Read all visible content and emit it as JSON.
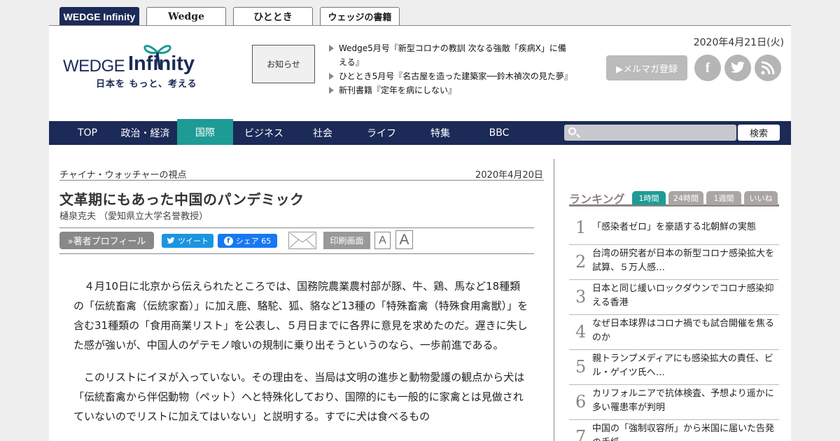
{
  "site_tabs": [
    "WEDGE Infinity",
    "Wedge",
    "ひととき",
    "ウェッジの書籍"
  ],
  "logo": {
    "wedge": "WEDGE",
    "infinity": "Infinity",
    "tagline": "日本を もっと、考える"
  },
  "notice_label": "お知らせ",
  "news": [
    "Wedge5月号『新型コロナの教訓 次なる強敵「疾病X」に備える』",
    "ひととき5月号『名古屋を造った建築家──鈴木禎次の見た夢』",
    "新刊書籍『定年を病にしない』"
  ],
  "header_date": "2020年4月21日(火)",
  "mailmag_label": "▶メルマガ登録",
  "social_icons": [
    "facebook-icon",
    "twitter-icon",
    "rss-icon"
  ],
  "nav": [
    "TOP",
    "政治・経済",
    "国際",
    "ビジネス",
    "社会",
    "ライフ",
    "特集",
    "BBC"
  ],
  "nav_active": "国際",
  "search": {
    "placeholder": "",
    "button": "検索"
  },
  "article": {
    "series": "チャイナ・ウォッチャーの視点",
    "date": "2020年4月20日",
    "title": "文革期にもあった中国のパンデミック",
    "author": "樋泉克夫 （愛知県立大学名誉教授）",
    "profile_btn": "»著者プロフィール",
    "tweet": "ツイート",
    "share": "シェア 65",
    "print": "印刷画面",
    "font_small": "A",
    "font_large": "A",
    "paragraphs": [
      "４月10日に北京から伝えられたところでは、国務院農業農村部が豚、牛、鶏、馬など18種類の「伝統畜禽（伝統家畜）」に加え鹿、駱駝、狐、貉など13種の「特殊畜禽（特殊食用禽獣）」を含む31種類の「食用商業リスト」を公表し、５月日までに各界に意見を求めたのだ。遅きに失した感が強いが、中国人のゲテモノ喰いの規制に乗り出そうというのなら、一歩前進である。",
      "このリストにイヌが入っていない。その理由を、当局は文明の進歩と動物愛護の観点から犬は「伝統畜禽から伴侶動物（ペット）へと特殊化しており、国際的にも一般的に家禽とは見做されていないのでリストに加えてはいない」と説明する。すでに犬は食べるもの"
    ]
  },
  "ranking": {
    "title": "ランキング",
    "tabs": [
      "1時間",
      "24時間",
      "1週間",
      "いいね"
    ],
    "active_tab": "1時間",
    "items": [
      {
        "rank": "1",
        "text": "「感染者ゼロ」を豪語する北朝鮮の実態"
      },
      {
        "rank": "2",
        "text": "台湾の研究者が日本の新型コロナ感染拡大を試算、５万人感…"
      },
      {
        "rank": "3",
        "text": "日本と同じ緩いロックダウンでコロナ感染抑える香港"
      },
      {
        "rank": "4",
        "text": "なぜ日本球界はコロナ禍でも試合開催を焦るのか"
      },
      {
        "rank": "5",
        "text": "親トランプメディアにも感染拡大の責任、ビル・ゲイツ氏へ…"
      },
      {
        "rank": "6",
        "text": "カリフォルニアで抗体検査、予想より遥かに多い罹患率が判明"
      },
      {
        "rank": "7",
        "text": "中国の「強制収容所」から米国に届いた告発の手紙"
      }
    ]
  }
}
